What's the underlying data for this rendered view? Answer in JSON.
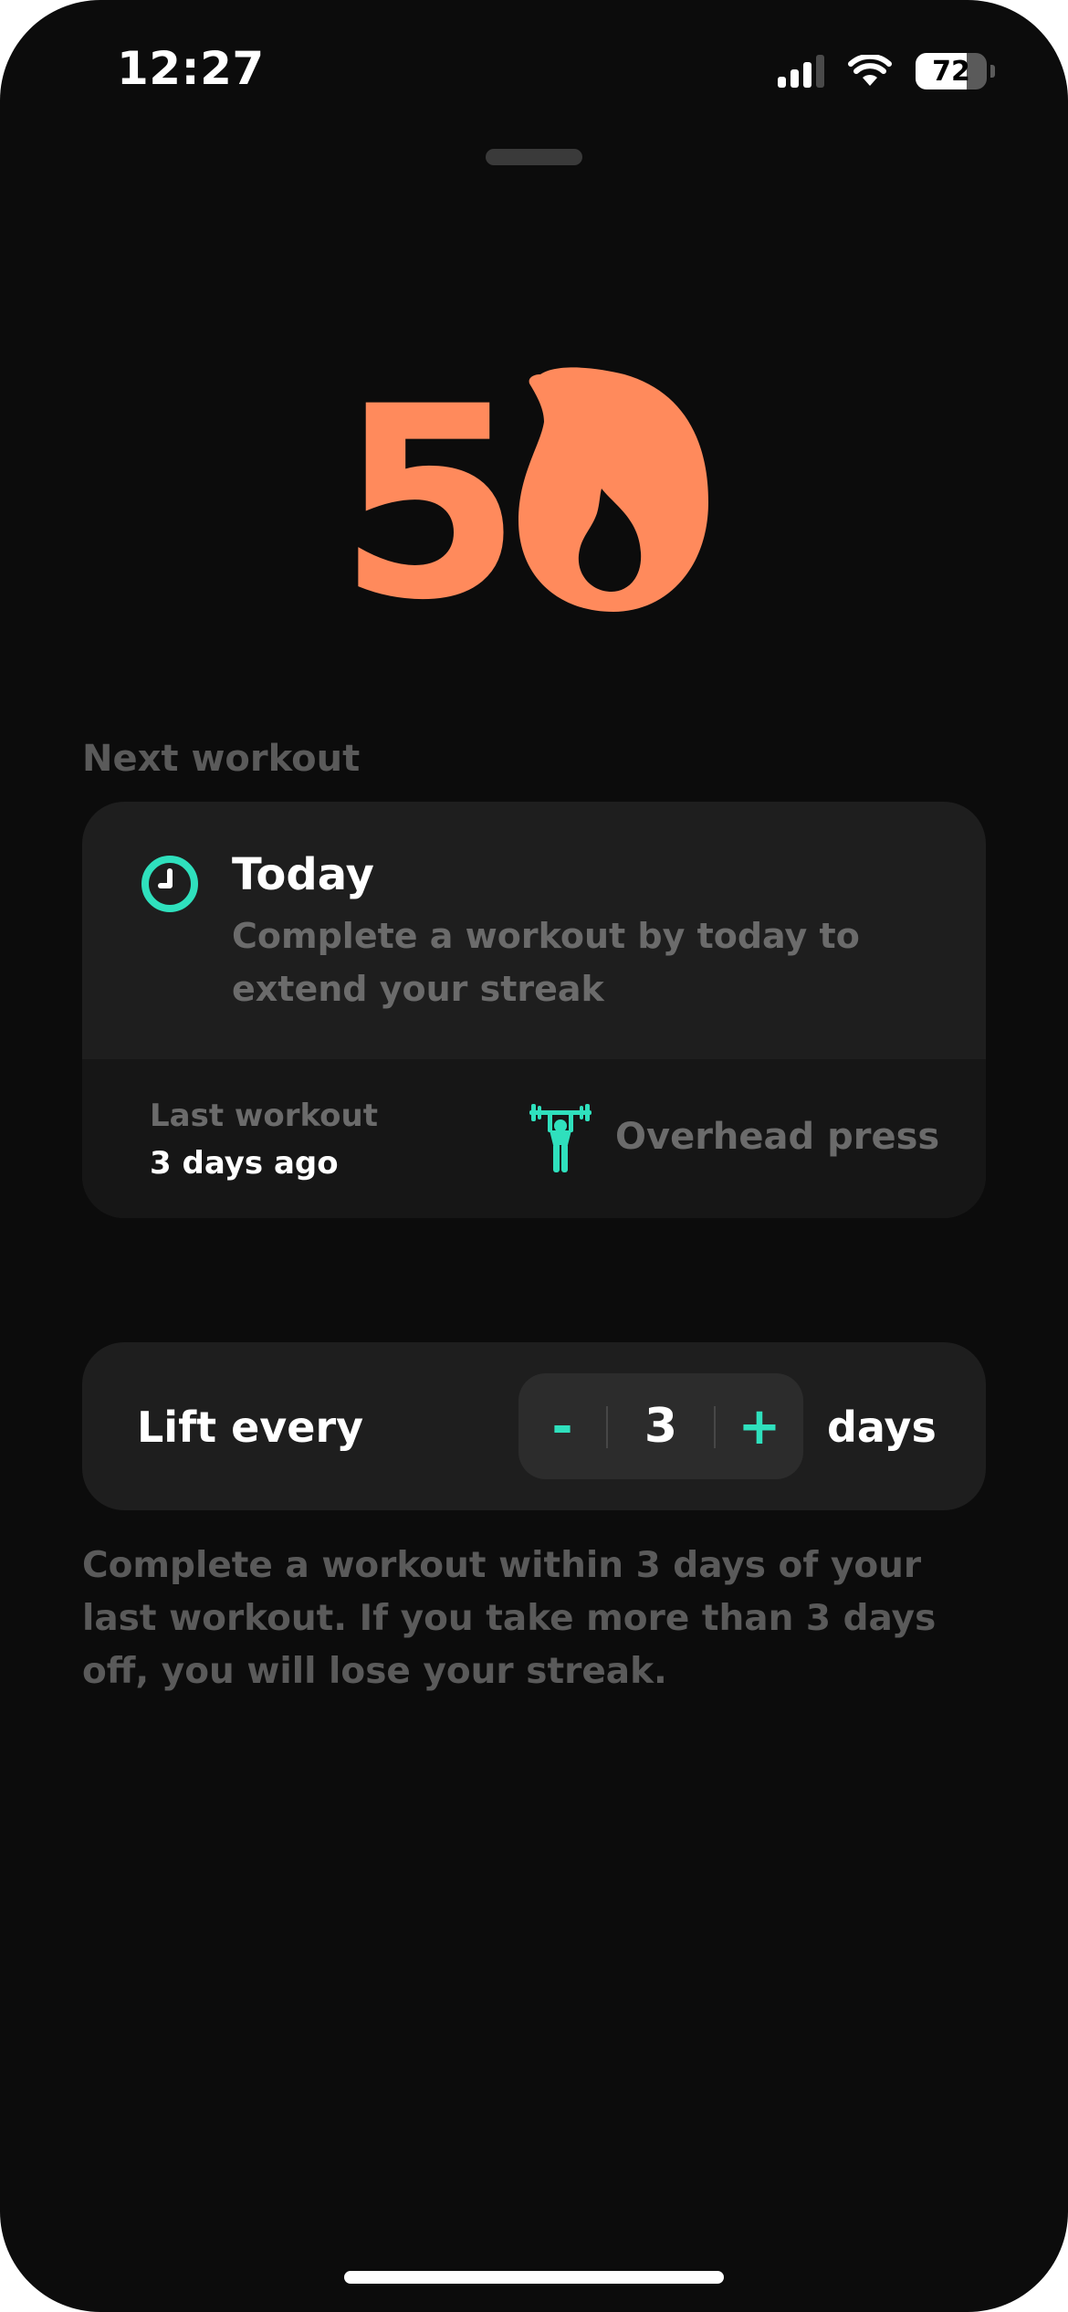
{
  "status_bar": {
    "time": "12:27",
    "battery_level": "72",
    "battery_fraction": 0.72,
    "signal_bars_active": 3,
    "signal_bars_total": 4
  },
  "streak": {
    "count": "5",
    "icon": "flame-icon",
    "color": "#ff8a5c"
  },
  "next_workout": {
    "section_label": "Next workout",
    "due_title": "Today",
    "due_description": "Complete a workout by today to extend your streak",
    "last_workout_label": "Last workout",
    "last_workout_value": "3 days ago",
    "exercise_icon": "weightlifter-icon",
    "exercise_name": "Overhead press"
  },
  "frequency": {
    "label": "Lift every",
    "decrement_label": "-",
    "value": "3",
    "increment_label": "+",
    "unit": "days"
  },
  "explanation": "Complete a workout within 3 days of your last workout. If you take more than 3 days off, you will lose your streak.",
  "colors": {
    "accent": "#2fe0bd",
    "streak": "#ff8a5c",
    "background": "#0c0c0c",
    "card": "#1e1e1e"
  }
}
